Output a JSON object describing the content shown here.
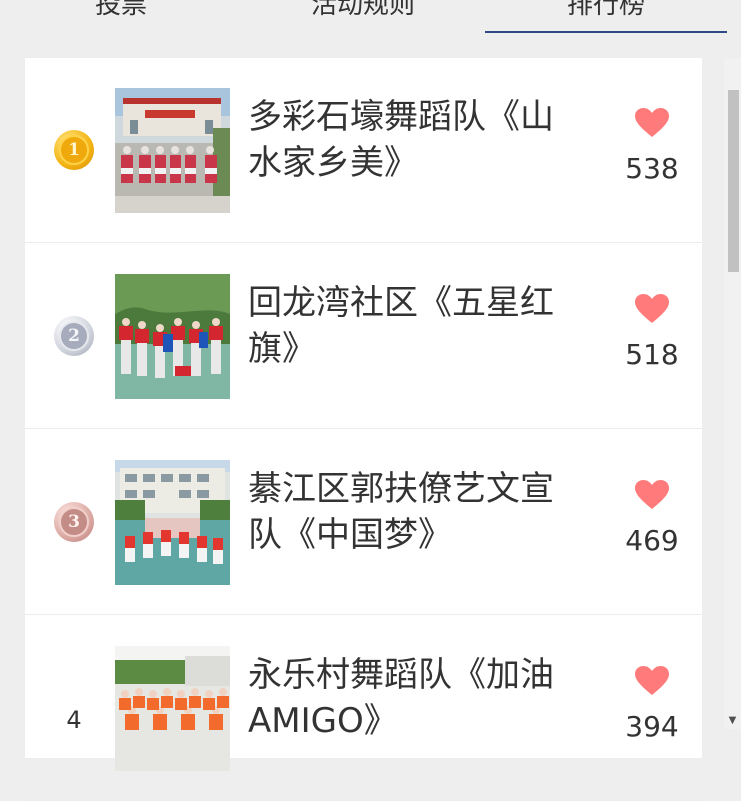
{
  "tabs": [
    {
      "label": "投票"
    },
    {
      "label": "活动规则"
    },
    {
      "label": "排行榜"
    }
  ],
  "accent_color": "#2d4a86",
  "heart_color": "#ff7b7b",
  "ranking": [
    {
      "rank": "1",
      "medal": "gold",
      "title": "多彩石壕舞蹈队《山水家乡美》",
      "votes": "538"
    },
    {
      "rank": "2",
      "medal": "silver",
      "title": "回龙湾社区《五星红旗》",
      "votes": "518"
    },
    {
      "rank": "3",
      "medal": "bronze",
      "title": "綦江区郭扶僚艺文宣队《中国梦》",
      "votes": "469"
    },
    {
      "rank": "4",
      "medal": "none",
      "title": "永乐村舞蹈队《加油AMIGO》",
      "votes": "394"
    }
  ],
  "scrollbar": {
    "arrow_icon": "chevron-down-icon"
  }
}
